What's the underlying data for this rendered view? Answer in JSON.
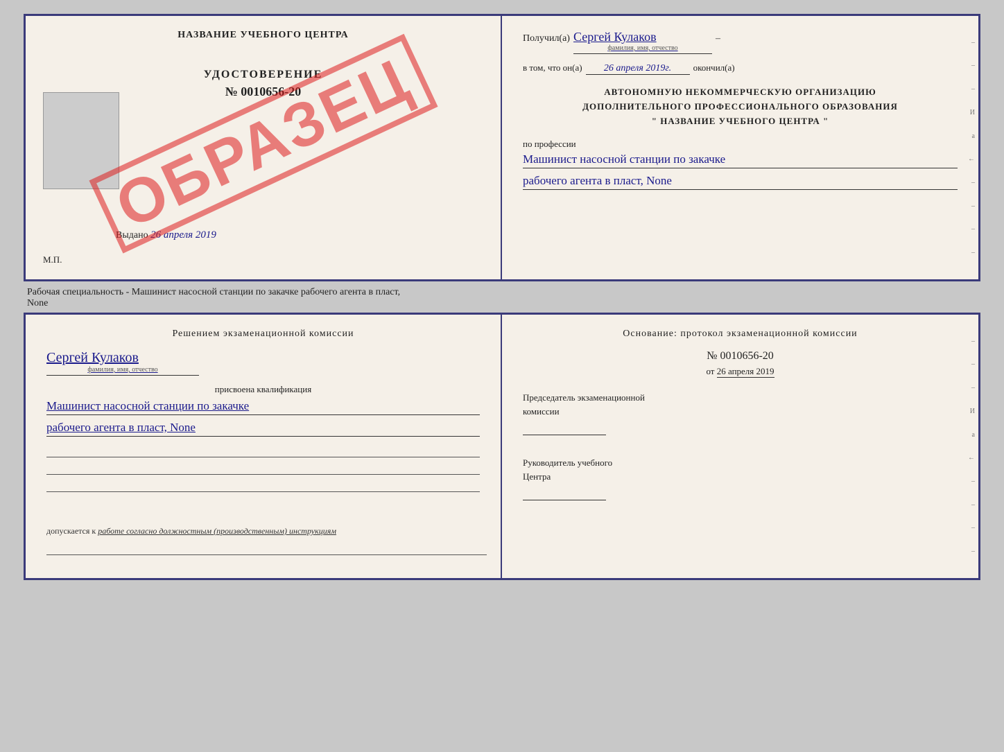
{
  "cert_top": {
    "left": {
      "title": "НАЗВАНИЕ УЧЕБНОГО ЦЕНТРА",
      "obrazec": "ОБРАЗЕЦ",
      "udostoverenie_label": "УДОСТОВЕРЕНИЕ",
      "number": "№ 0010656-20",
      "vydano_label": "Выдано",
      "vydano_date": "26 апреля 2019",
      "mp": "М.П."
    },
    "right": {
      "poluchil_label": "Получил(а)",
      "poluchil_name": "Сергей Кулаков",
      "fio_hint": "фамилия, имя, отчество",
      "dash": "–",
      "vtom_label": "в том, что он(а)",
      "date_value": "26 апреля 2019г.",
      "okончил_label": "окончил(а)",
      "org_line1": "АВТОНОМНУЮ НЕКОММЕРЧЕСКУЮ ОРГАНИЗАЦИЮ",
      "org_line2": "ДОПОЛНИТЕЛЬНОГО ПРОФЕССИОНАЛЬНОГО ОБРАЗОВАНИЯ",
      "org_line3": "\" НАЗВАНИЕ УЧЕБНОГО ЦЕНТРА \"",
      "po_professii": "по профессии",
      "profession_line1": "Машинист насосной станции по закачке",
      "profession_line2": "рабочего агента в пласт, None",
      "right_dashes": [
        "-",
        "-",
        "-",
        "И",
        "а",
        "←",
        "-",
        "-",
        "-",
        "-"
      ]
    }
  },
  "separator": {
    "text": "Рабочая специальность - Машинист насосной станции по закачке рабочего агента в пласт,",
    "text2": "None"
  },
  "cert_bottom": {
    "left": {
      "resheniem": "Решением экзаменационной комиссии",
      "name": "Сергей Кулаков",
      "fio_hint": "фамилия, имя, отчество",
      "prisvoena": "присвоена квалификация",
      "qual_line1": "Машинист насосной станции по закачке",
      "qual_line2": "рабочего агента в пласт, None",
      "blank_lines": [
        "",
        "",
        ""
      ],
      "dopusk_label": "допускается к",
      "dopusk_text": "работе согласно должностным (производственным) инструкциям",
      "blank_line_bottom": ""
    },
    "right": {
      "osnovanie": "Основание: протокол экзаменационной комиссии",
      "number": "№ 0010656-20",
      "ot_label": "от",
      "ot_date": "26 апреля 2019",
      "predsedatel_line1": "Председатель экзаменационной",
      "predsedatel_line2": "комиссии",
      "rukovoditel_line1": "Руководитель учебного",
      "rukovoditel_line2": "Центра",
      "right_dashes": [
        "-",
        "-",
        "-",
        "И",
        "а",
        "←",
        "-",
        "-",
        "-",
        "-"
      ]
    }
  }
}
